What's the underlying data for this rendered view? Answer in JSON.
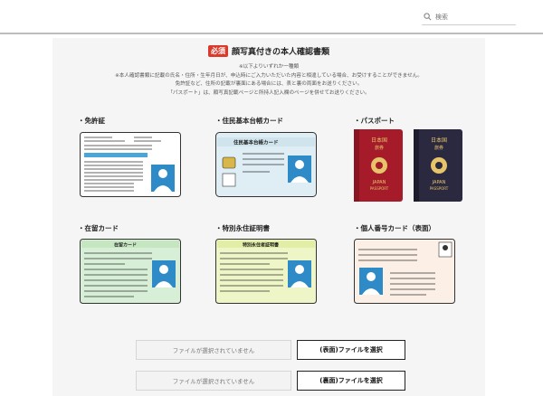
{
  "search": {
    "placeholder": "検索"
  },
  "section": {
    "badge": "必須",
    "title": "顔写真付きの本人確認書類",
    "notes": [
      "※以下よりいずれか一種類",
      "※本人確認書類に記載の氏名・住所・生年月日が、申込時にご入力いただいた内容と相違している場合、お受けすることができません。",
      "免許証など、住所の記載が裏面にある場合には、表と裏の両面をお送りください。",
      "「パスポート」は、顔写真記載ページと所持人記入欄のページを併せてお送りください。"
    ]
  },
  "documents": [
    {
      "label": "・免許証"
    },
    {
      "label": "・住民基本台帳カード",
      "card_text": "住民基本台帳カード"
    },
    {
      "label": "・パスポート",
      "passport_text": {
        "country": "日本国",
        "country_en": "JAPAN",
        "doc": "旅券",
        "doc_en": "PASSPORT"
      }
    },
    {
      "label": "・在留カード",
      "card_text": "在留カード"
    },
    {
      "label": "・特別永住証明書",
      "card_text": "特別永住者証明書"
    },
    {
      "label": "・個人番号カード（表面）"
    }
  ],
  "uploads": [
    {
      "status": "ファイルが選択されていません",
      "button": "(表面)ファイルを選択"
    },
    {
      "status": "ファイルが選択されていません",
      "button": "(裏面)ファイルを選択"
    }
  ]
}
